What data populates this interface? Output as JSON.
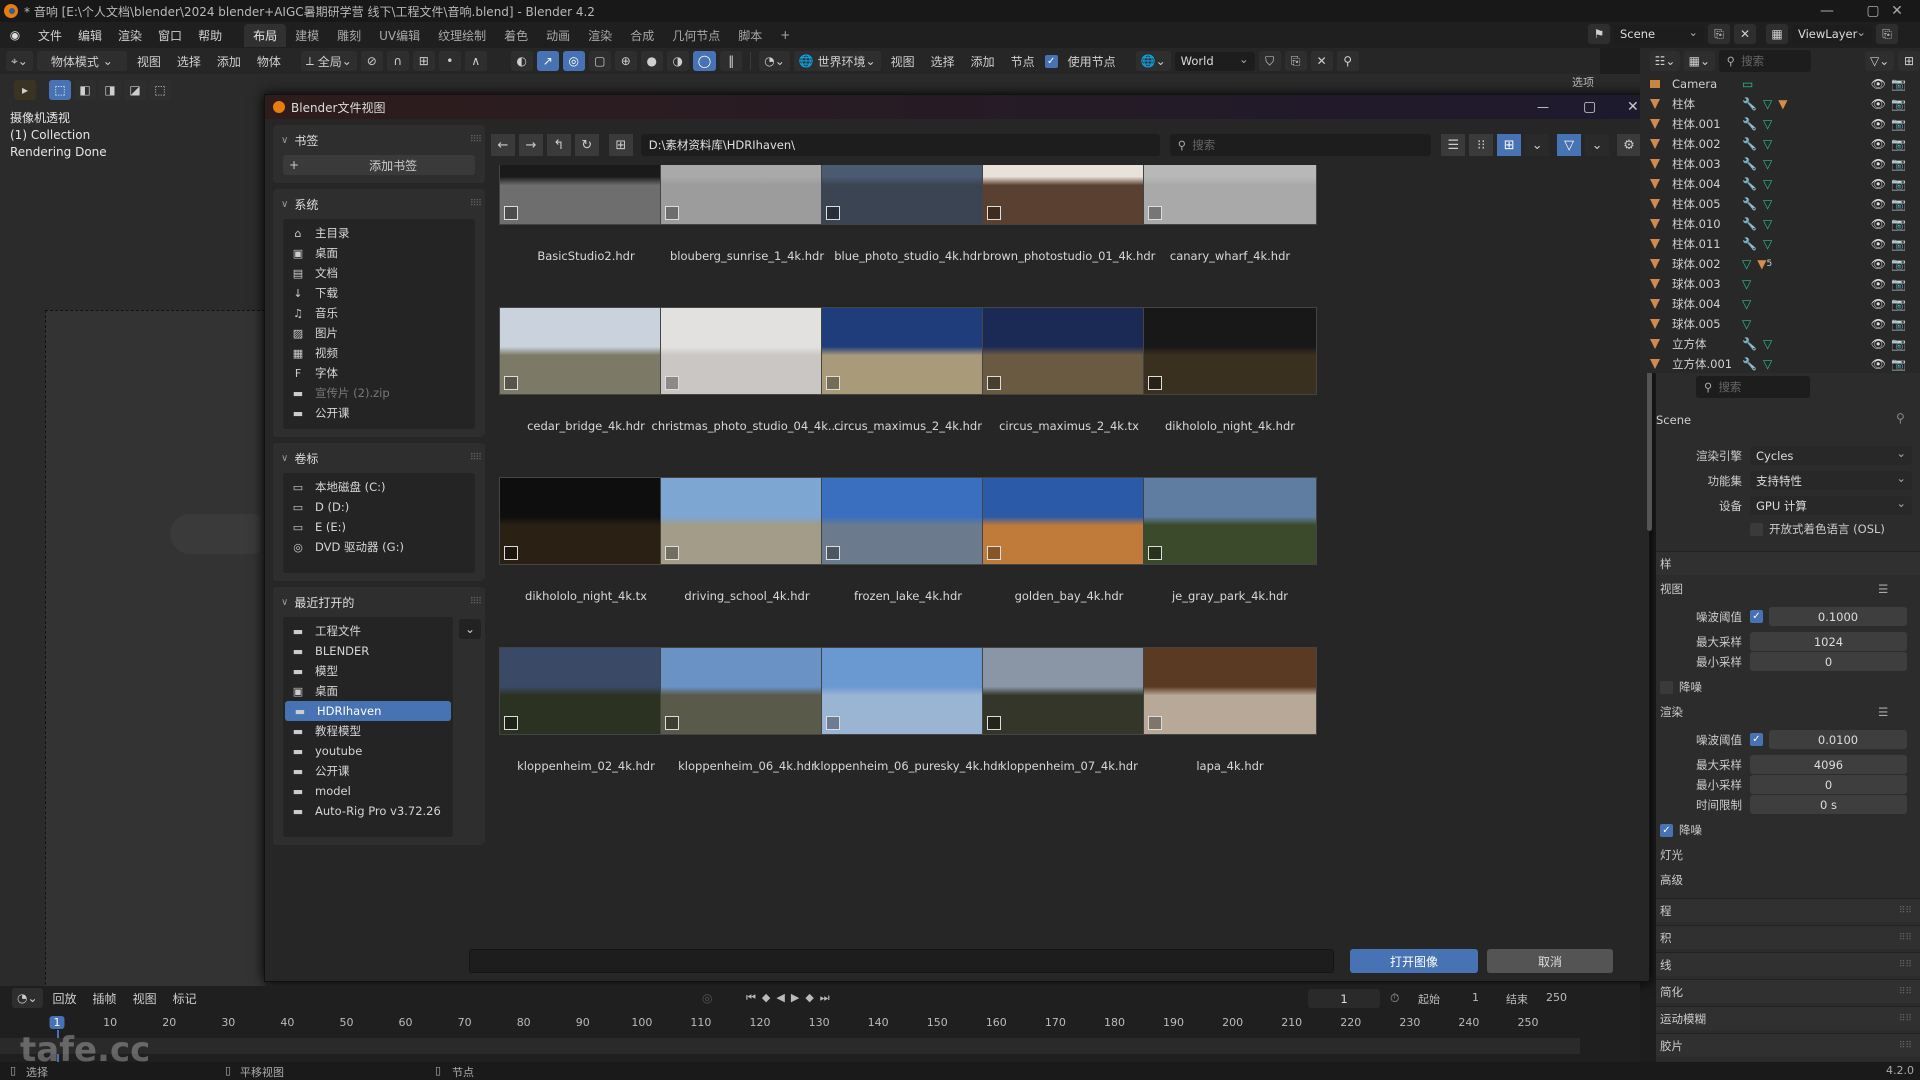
{
  "window": {
    "title": "* 音响 [E:\\个人文档\\blender\\2024 blender+AIGC暑期研学营 线下\\工程文件\\音响.blend] - Blender 4.2",
    "minimize": "—",
    "maximize": "▢",
    "close": "✕"
  },
  "menubar": {
    "items": [
      "文件",
      "编辑",
      "渲染",
      "窗口",
      "帮助"
    ],
    "workspace_tabs": [
      "布局",
      "建模",
      "雕刻",
      "UV编辑",
      "纹理绘制",
      "着色",
      "动画",
      "渲染",
      "合成",
      "几何节点",
      "脚本"
    ],
    "active_tab": "布局",
    "add_tab": "+",
    "scene": {
      "label": "Scene"
    },
    "view_layer": {
      "label": "ViewLayer"
    }
  },
  "toolbar": {
    "mode": "物体模式",
    "view": "视图",
    "select": "选择",
    "add": "添加",
    "object": "物体",
    "transform": "全局",
    "world_env": "世界环境",
    "node_view": "视图",
    "node_select": "选择",
    "node_add": "添加",
    "node_node": "节点",
    "use_nodes": "使用节点",
    "use_nodes_checked": true,
    "world_name": "World",
    "outliner_search_placeholder": "搜索"
  },
  "viewport": {
    "view_name": "摄像机透视",
    "collection": "(1) Collection",
    "status": "Rendering Done",
    "options_label": "选项"
  },
  "dialog": {
    "title": "Blender文件视图",
    "path": "D:\\素材资料库\\HDRIhaven\\",
    "search_placeholder": "搜索",
    "filename_value": "",
    "open_button": "打开图像",
    "cancel_button": "取消",
    "bookmarks": {
      "title": "书签",
      "add_button": "添加书签"
    },
    "system": {
      "title": "系统",
      "items": [
        {
          "label": "主目录",
          "icon": "home-icon"
        },
        {
          "label": "桌面",
          "icon": "desktop-icon"
        },
        {
          "label": "文档",
          "icon": "documents-icon"
        },
        {
          "label": "下载",
          "icon": "download-icon"
        },
        {
          "label": "音乐",
          "icon": "music-icon"
        },
        {
          "label": "图片",
          "icon": "image-icon"
        },
        {
          "label": "视频",
          "icon": "video-icon"
        },
        {
          "label": "字体",
          "icon": "font-icon"
        },
        {
          "label": "宣传片 (2).zip",
          "icon": "folder-icon",
          "dim": true
        },
        {
          "label": "公开课",
          "icon": "folder-icon"
        }
      ]
    },
    "volumes": {
      "title": "卷标",
      "items": [
        {
          "label": "本地磁盘 (C:)",
          "icon": "disk-icon"
        },
        {
          "label": "D (D:)",
          "icon": "disk-icon"
        },
        {
          "label": "E (E:)",
          "icon": "disk-icon"
        },
        {
          "label": "DVD 驱动器 (G:)",
          "icon": "dvd-icon"
        }
      ]
    },
    "recent": {
      "title": "最近打开的",
      "items": [
        {
          "label": "工程文件",
          "icon": "folder-icon"
        },
        {
          "label": "BLENDER",
          "icon": "folder-icon"
        },
        {
          "label": "模型",
          "icon": "folder-icon"
        },
        {
          "label": "桌面",
          "icon": "desktop-icon"
        },
        {
          "label": "HDRIhaven",
          "icon": "folder-icon",
          "selected": true
        },
        {
          "label": "教程模型",
          "icon": "folder-icon"
        },
        {
          "label": "youtube",
          "icon": "folder-icon"
        },
        {
          "label": "公开课",
          "icon": "folder-icon"
        },
        {
          "label": "model",
          "icon": "folder-icon"
        },
        {
          "label": "Auto-Rig Pro v3.72.26",
          "icon": "folder-icon"
        }
      ]
    },
    "files": [
      {
        "name": "BasicStudio2.hdr",
        "colors": [
          "#1a1a1a",
          "#6e6e6e"
        ]
      },
      {
        "name": "blouberg_sunrise_1_4k.hdr",
        "colors": [
          "#a9a9a9",
          "#9c9c9c"
        ]
      },
      {
        "name": "blue_photo_studio_4k.hdr",
        "colors": [
          "#4a5a70",
          "#3a4452"
        ]
      },
      {
        "name": "brown_photostudio_01_4k.hdr",
        "colors": [
          "#e8e2da",
          "#5a4030"
        ]
      },
      {
        "name": "canary_wharf_4k.hdr",
        "colors": [
          "#b8b8b8",
          "#a9a9a9"
        ]
      },
      {
        "name": "cedar_bridge_4k.hdr",
        "colors": [
          "#c9d2dd",
          "#7c7a66"
        ]
      },
      {
        "name": "christmas_photo_studio_04_4k....",
        "colors": [
          "#e3e1df",
          "#c9c6c4"
        ]
      },
      {
        "name": "circus_maximus_2_4k.hdr",
        "colors": [
          "#1f3d7a",
          "#a99a7a"
        ]
      },
      {
        "name": "circus_maximus_2_4k.tx",
        "colors": [
          "#1a2a55",
          "#6b5a42"
        ]
      },
      {
        "name": "dikhololo_night_4k.hdr",
        "colors": [
          "#181818",
          "#3a3020"
        ]
      },
      {
        "name": "dikhololo_night_4k.tx",
        "colors": [
          "#0e0e0e",
          "#2a2014"
        ]
      },
      {
        "name": "driving_school_4k.hdr",
        "colors": [
          "#7ea6d2",
          "#a29c88"
        ]
      },
      {
        "name": "frozen_lake_4k.hdr",
        "colors": [
          "#3a6fc0",
          "#6b7b8d"
        ]
      },
      {
        "name": "golden_bay_4k.hdr",
        "colors": [
          "#2a5aa8",
          "#c07a3a"
        ]
      },
      {
        "name": "je_gray_park_4k.hdr",
        "colors": [
          "#5f7da0",
          "#3a4a2a"
        ]
      },
      {
        "name": "kloppenheim_02_4k.hdr",
        "colors": [
          "#3a4a66",
          "#2c3222"
        ]
      },
      {
        "name": "kloppenheim_06_4k.hdr",
        "colors": [
          "#6a92c4",
          "#5a5a4a"
        ]
      },
      {
        "name": "kloppenheim_06_puresky_4k.hdr",
        "colors": [
          "#6a98d0",
          "#9ab4d4"
        ]
      },
      {
        "name": "kloppenheim_07_4k.hdr",
        "colors": [
          "#8a96a6",
          "#333628"
        ]
      },
      {
        "name": "lapa_4k.hdr",
        "colors": [
          "#5a3a22",
          "#b8a898"
        ]
      }
    ]
  },
  "outliner": {
    "items": [
      {
        "name": "Camera",
        "type": "camera"
      },
      {
        "name": "柱体",
        "modifier": true,
        "material": true
      },
      {
        "name": "柱体.001",
        "modifier": true
      },
      {
        "name": "柱体.002",
        "modifier": true
      },
      {
        "name": "柱体.003",
        "modifier": true
      },
      {
        "name": "柱体.004",
        "modifier": true
      },
      {
        "name": "柱体.005",
        "modifier": true
      },
      {
        "name": "柱体.010",
        "modifier": true
      },
      {
        "name": "柱体.011",
        "modifier": true
      },
      {
        "name": "球体.002",
        "material": true,
        "material_count": "5"
      },
      {
        "name": "球体.003"
      },
      {
        "name": "球体.004"
      },
      {
        "name": "球体.005"
      },
      {
        "name": "立方体",
        "modifier": true
      },
      {
        "name": "立方体.001",
        "modifier": true
      }
    ]
  },
  "properties": {
    "search_placeholder": "搜索",
    "context": "Scene",
    "render_engine_label": "渲染引擎",
    "render_engine": "Cycles",
    "feature_set_label": "功能集",
    "feature_set": "支持特性",
    "device_label": "设备",
    "device": "GPU 计算",
    "osl_label": "开放式着色语言 (OSL)",
    "osl_checked": false,
    "sampling_label": "样",
    "viewport_label": "视图",
    "vp_noise_label": "噪波阈值",
    "vp_noise_value": "0.1000",
    "vp_max_label": "最大采样",
    "vp_max_value": "1024",
    "vp_min_label": "最小采样",
    "vp_min_value": "0",
    "vp_denoise_label": "降噪",
    "vp_denoise_checked": false,
    "render_label": "渲染",
    "r_noise_label": "噪波阈值",
    "r_noise_value": "0.0100",
    "r_max_label": "最大采样",
    "r_max_value": "4096",
    "r_min_label": "最小采样",
    "r_min_value": "0",
    "r_time_label": "时间限制",
    "r_time_value": "0 s",
    "r_denoise_label": "降噪",
    "r_denoise_checked": true,
    "lights_label": "灯光",
    "advanced_label": "高级",
    "sections": [
      "程",
      "积",
      "线",
      "简化",
      "运动模糊",
      "胶片"
    ]
  },
  "timeline": {
    "menus": [
      "回放",
      "插帧",
      "视图",
      "标记"
    ],
    "current_frame": "1",
    "start_label": "起始",
    "start": "1",
    "end_label": "结束",
    "end": "250",
    "ticks": [
      "1",
      "10",
      "20",
      "30",
      "40",
      "50",
      "60",
      "70",
      "80",
      "90",
      "100",
      "110",
      "120",
      "130",
      "140",
      "150",
      "160",
      "170",
      "180",
      "190",
      "200",
      "210",
      "220",
      "230",
      "240",
      "250"
    ]
  },
  "statusbar": {
    "select": "选择",
    "pan": "平移视图",
    "node": "节点",
    "version": "4.2.0",
    "watermark": "tafe.cc"
  }
}
